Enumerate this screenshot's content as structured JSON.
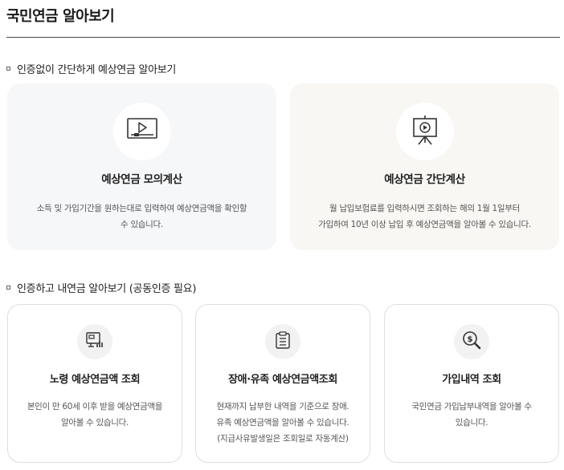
{
  "page": {
    "title": "국민연금 알아보기"
  },
  "section1": {
    "heading": "인증없이 간단하게 예상연금 알아보기",
    "cards": [
      {
        "title": "예상연금 모의계산",
        "icon": "video-player-icon",
        "desc_lines": [
          "소득 및 가입기간을 원하는대로 입력하여 예상연금액을 확인할",
          "수 있습니다."
        ]
      },
      {
        "title": "예상연금 간단계산",
        "icon": "presentation-board-icon",
        "desc_lines": [
          "월 납입보험료를 입력하시면 조회하는 해의 1월 1일부터",
          "가입하여 10년 이상 납입 후 예상연금액을 알아볼 수 있습니다."
        ]
      }
    ]
  },
  "section2": {
    "heading": "인증하고 내연금 알아보기 (공동인증 필요)",
    "cards": [
      {
        "title": "노령 예상연금액 조회",
        "icon": "monitor-chart-icon",
        "desc_lines": [
          "본인이 만 60세 이후 받을 예상연금액을",
          "알아볼 수 있습니다."
        ]
      },
      {
        "title": "장애·유족 예상연금액조회",
        "icon": "clipboard-icon",
        "desc_lines": [
          "현재까지 납부한 내역을 기준으로 장애.",
          "유족 예상연금액을 알아볼 수 있습니다.",
          "(지급사유발생일은 조회일로 자동계산)"
        ]
      },
      {
        "title": "가입내역 조회",
        "icon": "dollar-magnifier-icon",
        "desc_lines": [
          "국민연금 가입납부내역을 알아볼 수",
          "있습니다."
        ]
      }
    ]
  }
}
